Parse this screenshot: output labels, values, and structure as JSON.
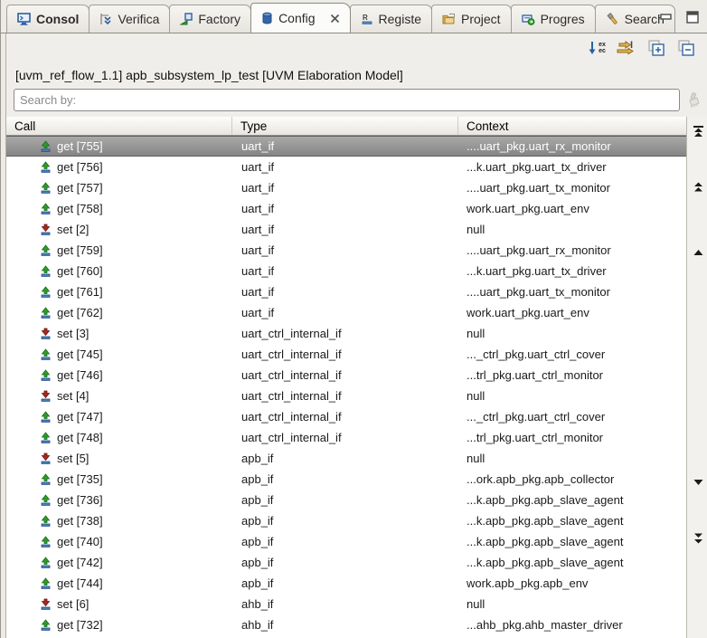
{
  "tabs": [
    {
      "label": "Consol",
      "icon": "console-icon",
      "bold": true,
      "active": false
    },
    {
      "label": "Verifica",
      "icon": "verification-icon",
      "bold": false,
      "active": false
    },
    {
      "label": "Factory",
      "icon": "factory-icon",
      "bold": false,
      "active": false
    },
    {
      "label": "Config",
      "icon": "config-icon",
      "bold": false,
      "active": true,
      "closable": true
    },
    {
      "label": "Registe",
      "icon": "register-icon",
      "bold": false,
      "active": false
    },
    {
      "label": "Project",
      "icon": "project-icon",
      "bold": false,
      "active": false
    },
    {
      "label": "Progres",
      "icon": "progress-icon",
      "bold": false,
      "active": false
    },
    {
      "label": "Search",
      "icon": "search-tab-icon",
      "bold": false,
      "active": false
    }
  ],
  "window_controls": [
    {
      "name": "minimize-button",
      "icon": "minimize-icon"
    },
    {
      "name": "maximize-button",
      "icon": "maximize-icon"
    }
  ],
  "toolbar": {
    "exec_order_text_top": "ex",
    "exec_order_text_bottom": "ec",
    "buttons": [
      {
        "name": "execution-order-button",
        "icon": "exec-order-icon"
      },
      {
        "name": "step-forward-button",
        "icon": "step-arrows-icon"
      },
      {
        "name": "expand-all-button",
        "icon": "expand-all-icon"
      },
      {
        "name": "collapse-all-button",
        "icon": "collapse-all-icon"
      }
    ]
  },
  "header": {
    "title": "[uvm_ref_flow_1.1] apb_subsystem_lp_test [UVM Elaboration Model]"
  },
  "search": {
    "placeholder": "Search by:",
    "value": ""
  },
  "table": {
    "columns": [
      "Call",
      "Type",
      "Context"
    ],
    "rows": [
      {
        "call": "get [755]",
        "kind": "get",
        "type": "uart_if",
        "context": "....uart_pkg.uart_rx_monitor",
        "selected": true
      },
      {
        "call": "get [756]",
        "kind": "get",
        "type": "uart_if",
        "context": "...k.uart_pkg.uart_tx_driver",
        "selected": false
      },
      {
        "call": "get [757]",
        "kind": "get",
        "type": "uart_if",
        "context": "....uart_pkg.uart_tx_monitor",
        "selected": false
      },
      {
        "call": "get [758]",
        "kind": "get",
        "type": "uart_if",
        "context": "work.uart_pkg.uart_env",
        "selected": false
      },
      {
        "call": "set [2]",
        "kind": "set",
        "type": "uart_if",
        "context": "null",
        "selected": false
      },
      {
        "call": "get [759]",
        "kind": "get",
        "type": "uart_if",
        "context": "....uart_pkg.uart_rx_monitor",
        "selected": false
      },
      {
        "call": "get [760]",
        "kind": "get",
        "type": "uart_if",
        "context": "...k.uart_pkg.uart_tx_driver",
        "selected": false
      },
      {
        "call": "get [761]",
        "kind": "get",
        "type": "uart_if",
        "context": "....uart_pkg.uart_tx_monitor",
        "selected": false
      },
      {
        "call": "get [762]",
        "kind": "get",
        "type": "uart_if",
        "context": "work.uart_pkg.uart_env",
        "selected": false
      },
      {
        "call": "set [3]",
        "kind": "set",
        "type": "uart_ctrl_internal_if",
        "context": "null",
        "selected": false
      },
      {
        "call": "get [745]",
        "kind": "get",
        "type": "uart_ctrl_internal_if",
        "context": "..._ctrl_pkg.uart_ctrl_cover",
        "selected": false
      },
      {
        "call": "get [746]",
        "kind": "get",
        "type": "uart_ctrl_internal_if",
        "context": "...trl_pkg.uart_ctrl_monitor",
        "selected": false
      },
      {
        "call": "set [4]",
        "kind": "set",
        "type": "uart_ctrl_internal_if",
        "context": "null",
        "selected": false
      },
      {
        "call": "get [747]",
        "kind": "get",
        "type": "uart_ctrl_internal_if",
        "context": "..._ctrl_pkg.uart_ctrl_cover",
        "selected": false
      },
      {
        "call": "get [748]",
        "kind": "get",
        "type": "uart_ctrl_internal_if",
        "context": "...trl_pkg.uart_ctrl_monitor",
        "selected": false
      },
      {
        "call": "set [5]",
        "kind": "set",
        "type": "apb_if",
        "context": "null",
        "selected": false
      },
      {
        "call": "get [735]",
        "kind": "get",
        "type": "apb_if",
        "context": "...ork.apb_pkg.apb_collector",
        "selected": false
      },
      {
        "call": "get [736]",
        "kind": "get",
        "type": "apb_if",
        "context": "...k.apb_pkg.apb_slave_agent",
        "selected": false
      },
      {
        "call": "get [738]",
        "kind": "get",
        "type": "apb_if",
        "context": "...k.apb_pkg.apb_slave_agent",
        "selected": false
      },
      {
        "call": "get [740]",
        "kind": "get",
        "type": "apb_if",
        "context": "...k.apb_pkg.apb_slave_agent",
        "selected": false
      },
      {
        "call": "get [742]",
        "kind": "get",
        "type": "apb_if",
        "context": "...k.apb_pkg.apb_slave_agent",
        "selected": false
      },
      {
        "call": "get [744]",
        "kind": "get",
        "type": "apb_if",
        "context": "work.apb_pkg.apb_env",
        "selected": false
      },
      {
        "call": "set [6]",
        "kind": "set",
        "type": "ahb_if",
        "context": "null",
        "selected": false
      },
      {
        "call": "get [732]",
        "kind": "get",
        "type": "ahb_if",
        "context": "...ahb_pkg.ahb_master_driver",
        "selected": false
      }
    ]
  },
  "scroll_rail": {
    "markers": [
      {
        "name": "scroll-to-top-button",
        "icon": "scroll-top-icon"
      },
      {
        "name": "scroll-up-double-button",
        "icon": "double-up-icon"
      },
      {
        "name": "scroll-up-button",
        "icon": "up-icon"
      },
      {
        "name": "scroll-down-button",
        "icon": "down-icon"
      },
      {
        "name": "scroll-down-double-button",
        "icon": "double-down-icon"
      }
    ]
  },
  "colors": {
    "accent_blue": "#3465a4",
    "get_green": "#2e9b2e",
    "set_red": "#a52a22",
    "selected_row_top": "#a9a9a9",
    "selected_row_bottom": "#858585",
    "panel_bg": "#f0eeea",
    "tabbar_bg": "#ecebe6"
  }
}
